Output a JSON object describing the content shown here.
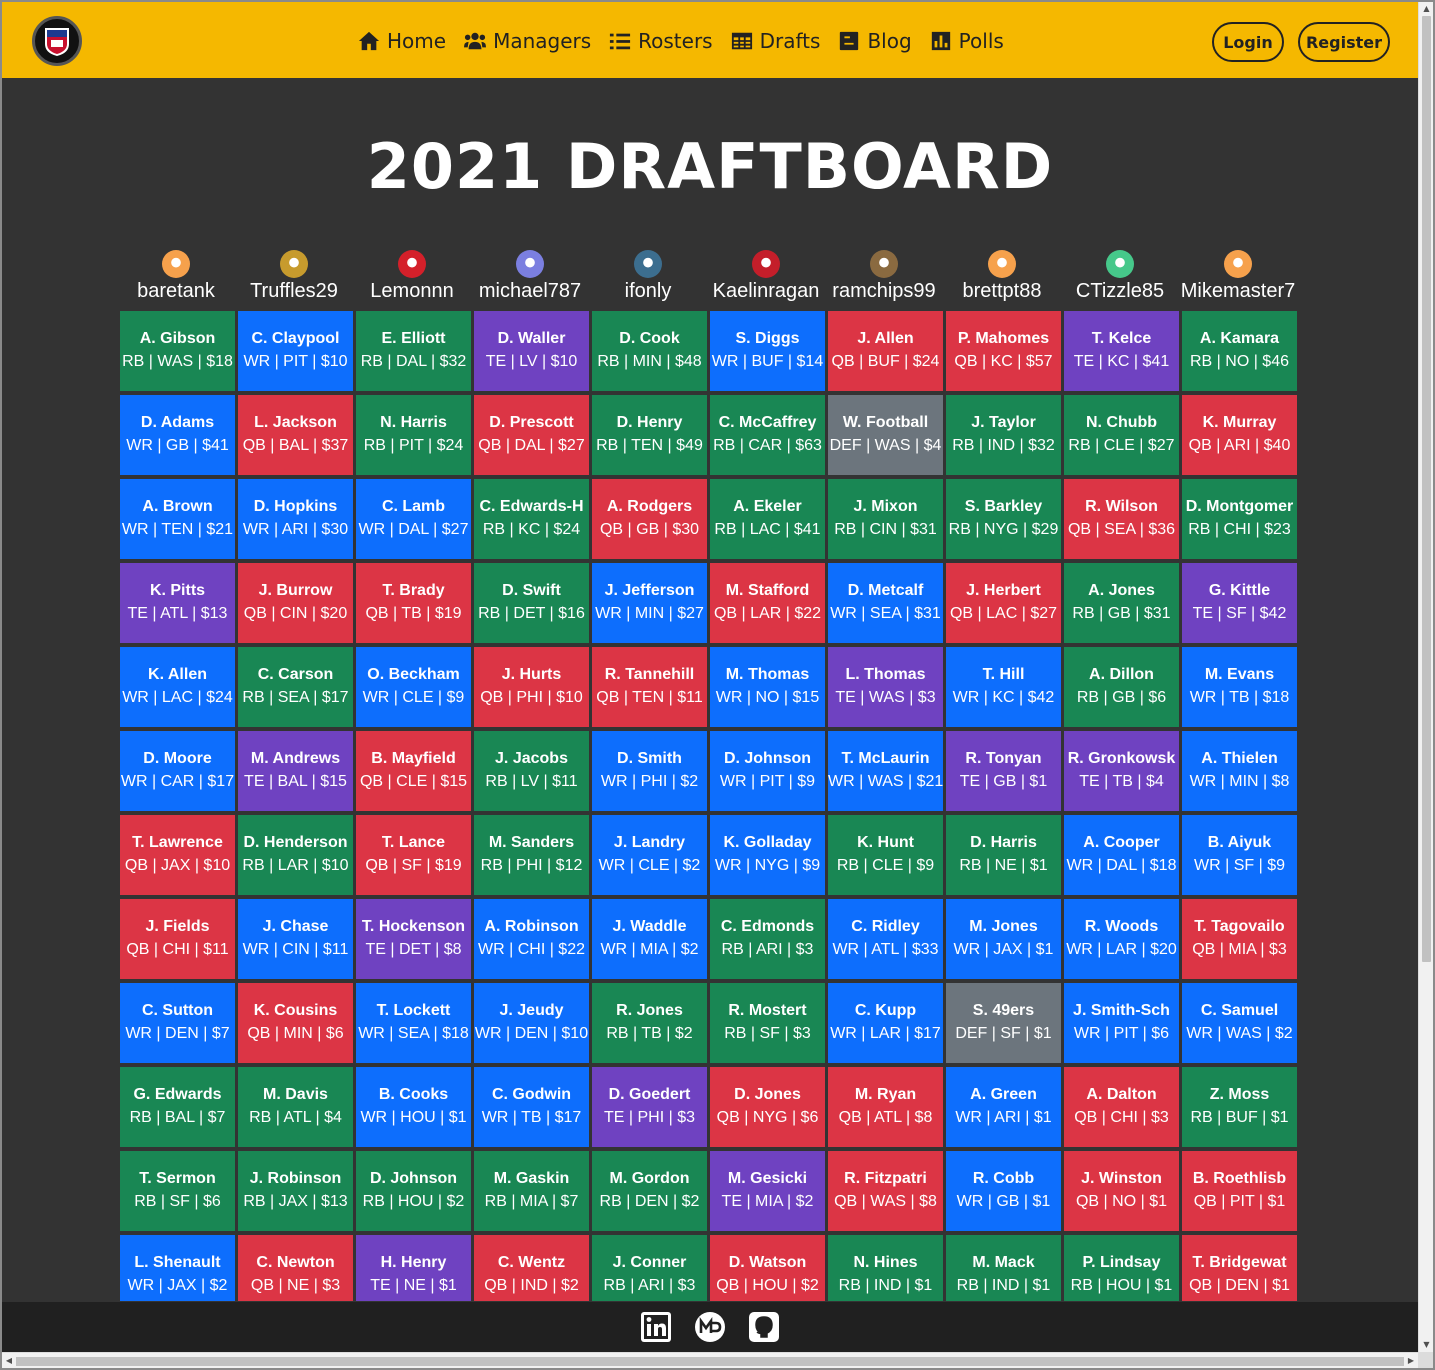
{
  "nav": {
    "links": [
      "Home",
      "Managers",
      "Rosters",
      "Drafts",
      "Blog",
      "Polls"
    ],
    "login": "Login",
    "register": "Register"
  },
  "title": "2021 DRAFTBOARD",
  "managers": [
    {
      "name": "baretank",
      "avatar_color": "#f6a14c"
    },
    {
      "name": "Truffles29",
      "avatar_color": "#c79b2d"
    },
    {
      "name": "Lemonnn",
      "avatar_color": "#d4202a"
    },
    {
      "name": "michael787",
      "avatar_color": "#7b7fe0"
    },
    {
      "name": "ifonly",
      "avatar_color": "#3c6e8f"
    },
    {
      "name": "Kaelinragan",
      "avatar_color": "#c41e2a"
    },
    {
      "name": "ramchips99",
      "avatar_color": "#8a6a40"
    },
    {
      "name": "brettpt88",
      "avatar_color": "#f6a14c"
    },
    {
      "name": "CTizzle85",
      "avatar_color": "#46c88a"
    },
    {
      "name": "Mikemaster7",
      "avatar_color": "#f6a14c"
    }
  ],
  "position_colors": {
    "QB": "#dc3545",
    "RB": "#198754",
    "WR": "#0d6efd",
    "TE": "#6f42c1",
    "DEF": "#6c757d"
  },
  "rounds": [
    [
      {
        "name": "A. Gibson",
        "info": "RB | WAS | $18",
        "pos": "RB"
      },
      {
        "name": "C. Claypool",
        "info": "WR | PIT | $10",
        "pos": "WR"
      },
      {
        "name": "E. Elliott",
        "info": "RB | DAL | $32",
        "pos": "RB"
      },
      {
        "name": "D. Waller",
        "info": "TE | LV | $10",
        "pos": "TE"
      },
      {
        "name": "D. Cook",
        "info": "RB | MIN | $48",
        "pos": "RB"
      },
      {
        "name": "S. Diggs",
        "info": "WR | BUF | $14",
        "pos": "WR"
      },
      {
        "name": "J. Allen",
        "info": "QB | BUF | $24",
        "pos": "QB"
      },
      {
        "name": "P. Mahomes",
        "info": "QB | KC | $57",
        "pos": "QB"
      },
      {
        "name": "T. Kelce",
        "info": "TE | KC | $41",
        "pos": "TE"
      },
      {
        "name": "A. Kamara",
        "info": "RB | NO | $46",
        "pos": "RB"
      }
    ],
    [
      {
        "name": "D. Adams",
        "info": "WR | GB | $41",
        "pos": "WR"
      },
      {
        "name": "L. Jackson",
        "info": "QB | BAL | $37",
        "pos": "QB"
      },
      {
        "name": "N. Harris",
        "info": "RB | PIT | $24",
        "pos": "RB"
      },
      {
        "name": "D. Prescott",
        "info": "QB | DAL | $27",
        "pos": "QB"
      },
      {
        "name": "D. Henry",
        "info": "RB | TEN | $49",
        "pos": "RB"
      },
      {
        "name": "C. McCaffrey",
        "info": "RB | CAR | $63",
        "pos": "RB"
      },
      {
        "name": "W. Football",
        "info": "DEF | WAS | $4",
        "pos": "DEF"
      },
      {
        "name": "J. Taylor",
        "info": "RB | IND | $32",
        "pos": "RB"
      },
      {
        "name": "N. Chubb",
        "info": "RB | CLE | $27",
        "pos": "RB"
      },
      {
        "name": "K. Murray",
        "info": "QB | ARI | $40",
        "pos": "QB"
      }
    ],
    [
      {
        "name": "A. Brown",
        "info": "WR | TEN | $21",
        "pos": "WR"
      },
      {
        "name": "D. Hopkins",
        "info": "WR | ARI | $30",
        "pos": "WR"
      },
      {
        "name": "C. Lamb",
        "info": "WR | DAL | $27",
        "pos": "WR"
      },
      {
        "name": "C. Edwards-H",
        "info": "RB | KC | $24",
        "pos": "RB"
      },
      {
        "name": "A. Rodgers",
        "info": "QB | GB | $30",
        "pos": "QB"
      },
      {
        "name": "A. Ekeler",
        "info": "RB | LAC | $41",
        "pos": "RB"
      },
      {
        "name": "J. Mixon",
        "info": "RB | CIN | $31",
        "pos": "RB"
      },
      {
        "name": "S. Barkley",
        "info": "RB | NYG | $29",
        "pos": "RB"
      },
      {
        "name": "R. Wilson",
        "info": "QB | SEA | $36",
        "pos": "QB"
      },
      {
        "name": "D. Montgomer",
        "info": "RB | CHI | $23",
        "pos": "RB"
      }
    ],
    [
      {
        "name": "K. Pitts",
        "info": "TE | ATL | $13",
        "pos": "TE"
      },
      {
        "name": "J. Burrow",
        "info": "QB | CIN | $20",
        "pos": "QB"
      },
      {
        "name": "T. Brady",
        "info": "QB | TB | $19",
        "pos": "QB"
      },
      {
        "name": "D. Swift",
        "info": "RB | DET | $16",
        "pos": "RB"
      },
      {
        "name": "J. Jefferson",
        "info": "WR | MIN | $27",
        "pos": "WR"
      },
      {
        "name": "M. Stafford",
        "info": "QB | LAR | $22",
        "pos": "QB"
      },
      {
        "name": "D. Metcalf",
        "info": "WR | SEA | $31",
        "pos": "WR"
      },
      {
        "name": "J. Herbert",
        "info": "QB | LAC | $27",
        "pos": "QB"
      },
      {
        "name": "A. Jones",
        "info": "RB | GB | $31",
        "pos": "RB"
      },
      {
        "name": "G. Kittle",
        "info": "TE | SF | $42",
        "pos": "TE"
      }
    ],
    [
      {
        "name": "K. Allen",
        "info": "WR | LAC | $24",
        "pos": "WR"
      },
      {
        "name": "C. Carson",
        "info": "RB | SEA | $17",
        "pos": "RB"
      },
      {
        "name": "O. Beckham",
        "info": "WR | CLE | $9",
        "pos": "WR"
      },
      {
        "name": "J. Hurts",
        "info": "QB | PHI | $10",
        "pos": "QB"
      },
      {
        "name": "R. Tannehill",
        "info": "QB | TEN | $11",
        "pos": "QB"
      },
      {
        "name": "M. Thomas",
        "info": "WR | NO | $15",
        "pos": "WR"
      },
      {
        "name": "L. Thomas",
        "info": "TE | WAS | $3",
        "pos": "TE"
      },
      {
        "name": "T. Hill",
        "info": "WR | KC | $42",
        "pos": "WR"
      },
      {
        "name": "A. Dillon",
        "info": "RB | GB | $6",
        "pos": "RB"
      },
      {
        "name": "M. Evans",
        "info": "WR | TB | $18",
        "pos": "WR"
      }
    ],
    [
      {
        "name": "D. Moore",
        "info": "WR | CAR | $17",
        "pos": "WR"
      },
      {
        "name": "M. Andrews",
        "info": "TE | BAL | $15",
        "pos": "TE"
      },
      {
        "name": "B. Mayfield",
        "info": "QB | CLE | $15",
        "pos": "QB"
      },
      {
        "name": "J. Jacobs",
        "info": "RB | LV | $11",
        "pos": "RB"
      },
      {
        "name": "D. Smith",
        "info": "WR | PHI | $2",
        "pos": "WR"
      },
      {
        "name": "D. Johnson",
        "info": "WR | PIT | $9",
        "pos": "WR"
      },
      {
        "name": "T. McLaurin",
        "info": "WR | WAS | $21",
        "pos": "WR"
      },
      {
        "name": "R. Tonyan",
        "info": "TE | GB | $1",
        "pos": "TE"
      },
      {
        "name": "R. Gronkowsk",
        "info": "TE | TB | $4",
        "pos": "TE"
      },
      {
        "name": "A. Thielen",
        "info": "WR | MIN | $8",
        "pos": "WR"
      }
    ],
    [
      {
        "name": "T. Lawrence",
        "info": "QB | JAX | $10",
        "pos": "QB"
      },
      {
        "name": "D. Henderson",
        "info": "RB | LAR | $10",
        "pos": "RB"
      },
      {
        "name": "T. Lance",
        "info": "QB | SF | $19",
        "pos": "QB"
      },
      {
        "name": "M. Sanders",
        "info": "RB | PHI | $12",
        "pos": "RB"
      },
      {
        "name": "J. Landry",
        "info": "WR | CLE | $2",
        "pos": "WR"
      },
      {
        "name": "K. Golladay",
        "info": "WR | NYG | $9",
        "pos": "WR"
      },
      {
        "name": "K. Hunt",
        "info": "RB | CLE | $9",
        "pos": "RB"
      },
      {
        "name": "D. Harris",
        "info": "RB | NE | $1",
        "pos": "RB"
      },
      {
        "name": "A. Cooper",
        "info": "WR | DAL | $18",
        "pos": "WR"
      },
      {
        "name": "B. Aiyuk",
        "info": "WR | SF | $9",
        "pos": "WR"
      }
    ],
    [
      {
        "name": "J. Fields",
        "info": "QB | CHI | $11",
        "pos": "QB"
      },
      {
        "name": "J. Chase",
        "info": "WR | CIN | $11",
        "pos": "WR"
      },
      {
        "name": "T. Hockenson",
        "info": "TE | DET | $8",
        "pos": "TE"
      },
      {
        "name": "A. Robinson",
        "info": "WR | CHI | $22",
        "pos": "WR"
      },
      {
        "name": "J. Waddle",
        "info": "WR | MIA | $2",
        "pos": "WR"
      },
      {
        "name": "C. Edmonds",
        "info": "RB | ARI | $3",
        "pos": "RB"
      },
      {
        "name": "C. Ridley",
        "info": "WR | ATL | $33",
        "pos": "WR"
      },
      {
        "name": "M. Jones",
        "info": "WR | JAX | $1",
        "pos": "WR"
      },
      {
        "name": "R. Woods",
        "info": "WR | LAR | $20",
        "pos": "WR"
      },
      {
        "name": "T. Tagovailo",
        "info": "QB | MIA | $3",
        "pos": "QB"
      }
    ],
    [
      {
        "name": "C. Sutton",
        "info": "WR | DEN | $7",
        "pos": "WR"
      },
      {
        "name": "K. Cousins",
        "info": "QB | MIN | $6",
        "pos": "QB"
      },
      {
        "name": "T. Lockett",
        "info": "WR | SEA | $18",
        "pos": "WR"
      },
      {
        "name": "J. Jeudy",
        "info": "WR | DEN | $10",
        "pos": "WR"
      },
      {
        "name": "R. Jones",
        "info": "RB | TB | $2",
        "pos": "RB"
      },
      {
        "name": "R. Mostert",
        "info": "RB | SF | $3",
        "pos": "RB"
      },
      {
        "name": "C. Kupp",
        "info": "WR | LAR | $17",
        "pos": "WR"
      },
      {
        "name": "S. 49ers",
        "info": "DEF | SF | $1",
        "pos": "DEF"
      },
      {
        "name": "J. Smith-Sch",
        "info": "WR | PIT | $6",
        "pos": "WR"
      },
      {
        "name": "C. Samuel",
        "info": "WR | WAS | $2",
        "pos": "WR"
      }
    ],
    [
      {
        "name": "G. Edwards",
        "info": "RB | BAL | $7",
        "pos": "RB"
      },
      {
        "name": "M. Davis",
        "info": "RB | ATL | $4",
        "pos": "RB"
      },
      {
        "name": "B. Cooks",
        "info": "WR | HOU | $1",
        "pos": "WR"
      },
      {
        "name": "C. Godwin",
        "info": "WR | TB | $17",
        "pos": "WR"
      },
      {
        "name": "D. Goedert",
        "info": "TE | PHI | $3",
        "pos": "TE"
      },
      {
        "name": "D. Jones",
        "info": "QB | NYG | $6",
        "pos": "QB"
      },
      {
        "name": "M. Ryan",
        "info": "QB | ATL | $8",
        "pos": "QB"
      },
      {
        "name": "A. Green",
        "info": "WR | ARI | $1",
        "pos": "WR"
      },
      {
        "name": "A. Dalton",
        "info": "QB | CHI | $3",
        "pos": "QB"
      },
      {
        "name": "Z. Moss",
        "info": "RB | BUF | $1",
        "pos": "RB"
      }
    ],
    [
      {
        "name": "T. Sermon",
        "info": "RB | SF | $6",
        "pos": "RB"
      },
      {
        "name": "J. Robinson",
        "info": "RB | JAX | $13",
        "pos": "RB"
      },
      {
        "name": "D. Johnson",
        "info": "RB | HOU | $2",
        "pos": "RB"
      },
      {
        "name": "M. Gaskin",
        "info": "RB | MIA | $7",
        "pos": "RB"
      },
      {
        "name": "M. Gordon",
        "info": "RB | DEN | $2",
        "pos": "RB"
      },
      {
        "name": "M. Gesicki",
        "info": "TE | MIA | $2",
        "pos": "TE"
      },
      {
        "name": "R. Fitzpatri",
        "info": "QB | WAS | $8",
        "pos": "QB"
      },
      {
        "name": "R. Cobb",
        "info": "WR | GB | $1",
        "pos": "WR"
      },
      {
        "name": "J. Winston",
        "info": "QB | NO | $1",
        "pos": "QB"
      },
      {
        "name": "B. Roethlisb",
        "info": "QB | PIT | $1",
        "pos": "QB"
      }
    ],
    [
      {
        "name": "L. Shenault",
        "info": "WR | JAX | $2",
        "pos": "WR"
      },
      {
        "name": "C. Newton",
        "info": "QB | NE | $3",
        "pos": "QB"
      },
      {
        "name": "H. Henry",
        "info": "TE | NE | $1",
        "pos": "TE"
      },
      {
        "name": "C. Wentz",
        "info": "QB | IND | $2",
        "pos": "QB"
      },
      {
        "name": "J. Conner",
        "info": "RB | ARI | $3",
        "pos": "RB"
      },
      {
        "name": "D. Watson",
        "info": "QB | HOU | $2",
        "pos": "QB"
      },
      {
        "name": "N. Hines",
        "info": "RB | IND | $1",
        "pos": "RB"
      },
      {
        "name": "M. Mack",
        "info": "RB | IND | $1",
        "pos": "RB"
      },
      {
        "name": "P. Lindsay",
        "info": "RB | HOU | $1",
        "pos": "RB"
      },
      {
        "name": "T. Bridgewat",
        "info": "QB | DEN | $1",
        "pos": "QB"
      }
    ]
  ],
  "footer": {
    "icons": [
      "linkedin-icon",
      "mp-icon",
      "github-icon"
    ]
  }
}
